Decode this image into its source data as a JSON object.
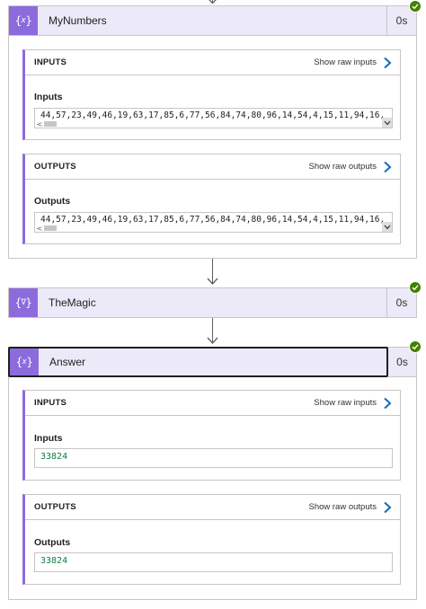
{
  "actions": [
    {
      "title": "MyNumbers",
      "duration": "0s",
      "icon": "variable-icon",
      "inputs": {
        "header": "INPUTS",
        "raw_link": "Show raw inputs",
        "label": "Inputs",
        "value": "44,57,23,49,46,19,63,17,85,6,77,56,84,74,80,96,14,54,4,15,11,94,16,"
      },
      "outputs": {
        "header": "OUTPUTS",
        "raw_link": "Show raw outputs",
        "label": "Outputs",
        "value": "44,57,23,49,46,19,63,17,85,6,77,56,84,74,80,96,14,54,4,15,11,94,16,"
      }
    },
    {
      "title": "TheMagic",
      "duration": "0s",
      "icon": "filter-variable-icon"
    },
    {
      "title": "Answer",
      "duration": "0s",
      "icon": "variable-icon",
      "inputs": {
        "header": "INPUTS",
        "raw_link": "Show raw inputs",
        "label": "Inputs",
        "value": "33824"
      },
      "outputs": {
        "header": "OUTPUTS",
        "raw_link": "Show raw outputs",
        "label": "Outputs",
        "value": "33824"
      }
    }
  ],
  "colors": {
    "accent": "#8c6cdc",
    "header_bg": "#ece9f8",
    "success": "#428000",
    "link_chevron": "#0f6cbd",
    "value_text_green": "#107c41"
  },
  "icons": {
    "status": "success-check-icon",
    "connector": "down-arrow-icon",
    "raw": "chevron-right-icon"
  }
}
